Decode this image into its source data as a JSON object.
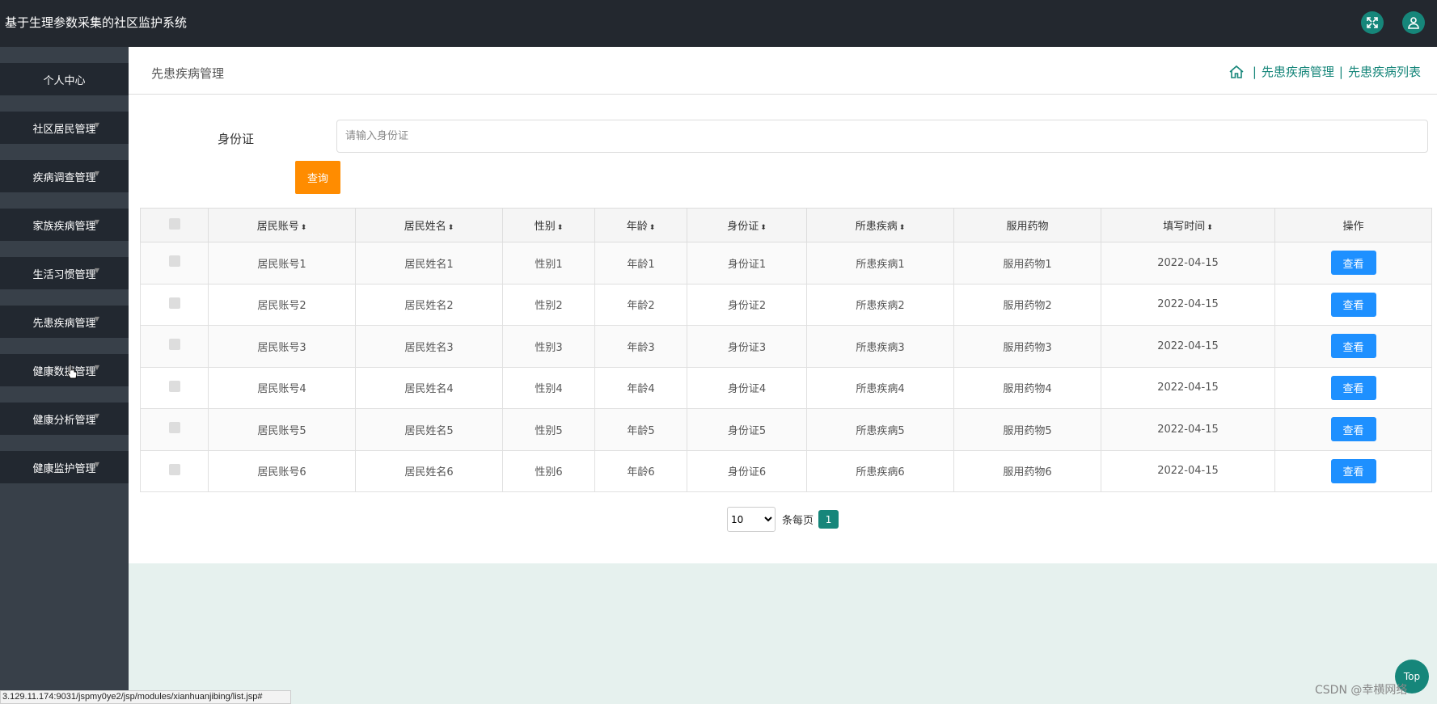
{
  "header": {
    "title": "基于生理参数采集的社区监护系统"
  },
  "sidebar": {
    "items": [
      {
        "label": "个人中心"
      },
      {
        "label": "社区居民管理"
      },
      {
        "label": "疾病调查管理"
      },
      {
        "label": "家族疾病管理"
      },
      {
        "label": "生活习惯管理"
      },
      {
        "label": "先患疾病管理"
      },
      {
        "label": "健康数据管理"
      },
      {
        "label": "健康分析管理"
      },
      {
        "label": "健康监护管理"
      }
    ]
  },
  "breadcrumb": {
    "page_title": "先患疾病管理",
    "crumb1": "先患疾病管理",
    "crumb2": "先患疾病列表",
    "sep": "|"
  },
  "search": {
    "label": "身份证",
    "placeholder": "请输入身份证",
    "button": "查询"
  },
  "table": {
    "headers": [
      "居民账号",
      "居民姓名",
      "性别",
      "年龄",
      "身份证",
      "所患疾病",
      "服用药物",
      "填写时间",
      "操作"
    ],
    "sort_icon": "⬍",
    "rows": [
      [
        "居民账号1",
        "居民姓名1",
        "性别1",
        "年龄1",
        "身份证1",
        "所患疾病1",
        "服用药物1",
        "2022-04-15"
      ],
      [
        "居民账号2",
        "居民姓名2",
        "性别2",
        "年龄2",
        "身份证2",
        "所患疾病2",
        "服用药物2",
        "2022-04-15"
      ],
      [
        "居民账号3",
        "居民姓名3",
        "性别3",
        "年龄3",
        "身份证3",
        "所患疾病3",
        "服用药物3",
        "2022-04-15"
      ],
      [
        "居民账号4",
        "居民姓名4",
        "性别4",
        "年龄4",
        "身份证4",
        "所患疾病4",
        "服用药物4",
        "2022-04-15"
      ],
      [
        "居民账号5",
        "居民姓名5",
        "性别5",
        "年龄5",
        "身份证5",
        "所患疾病5",
        "服用药物5",
        "2022-04-15"
      ],
      [
        "居民账号6",
        "居民姓名6",
        "性别6",
        "年龄6",
        "身份证6",
        "所患疾病6",
        "服用药物6",
        "2022-04-15"
      ]
    ],
    "view_label": "查看"
  },
  "pagination": {
    "page_size": "10",
    "per_page_label": "条每页",
    "current_page": "1"
  },
  "top_button": "Top",
  "status_url": "3.129.11.174:9031/jspmy0ye2/jsp/modules/xianhuanjibing/list.jsp#",
  "watermark": "CSDN @幸横网络",
  "icons": {
    "fullscreen": "expand-icon",
    "user": "user-icon",
    "home": "home-icon"
  },
  "colors": {
    "accent": "#16867a",
    "query": "#ff8c00",
    "view": "#1e90ff",
    "topbar": "#23282f",
    "sidebar": "#384049"
  }
}
